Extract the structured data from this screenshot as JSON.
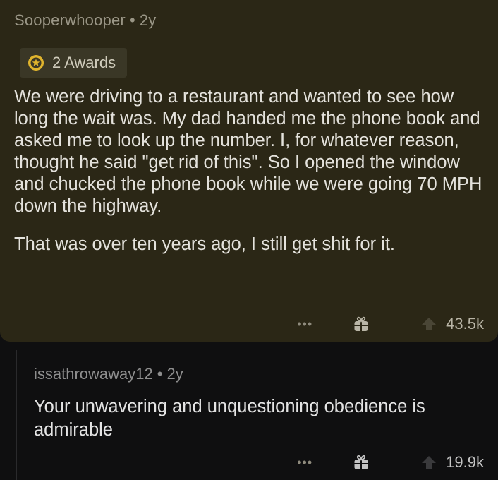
{
  "top_comment": {
    "username": "Sooperwhooper",
    "separator": "•",
    "age": "2y",
    "awards_label": "2 Awards",
    "paragraphs": [
      "We were driving to a restaurant and wanted to see how long the wait was. My dad handed me the phone book and asked me to look up the number. I, for whatever reason, thought he said \"get rid of this\". So I opened the window and chucked the phone book while we were going 70 MPH down the highway.",
      "That was over ten years ago, I still get shit for it."
    ],
    "more_label": "•••",
    "upvotes": "43.5k",
    "icons": {
      "award": "award-icon",
      "gift": "gift-icon",
      "upvote": "upvote-arrow-icon"
    }
  },
  "reply": {
    "username": "issathrowaway12",
    "separator": "•",
    "age": "2y",
    "body": "Your unwavering and unquestioning obedience is admirable",
    "more_label": "•••",
    "upvotes": "19.9k"
  },
  "colors": {
    "highlight_bg": "#2b2716",
    "page_bg": "#0f0f10",
    "award_pill_bg": "#3a3726",
    "award_gold": "#e0b42d"
  }
}
